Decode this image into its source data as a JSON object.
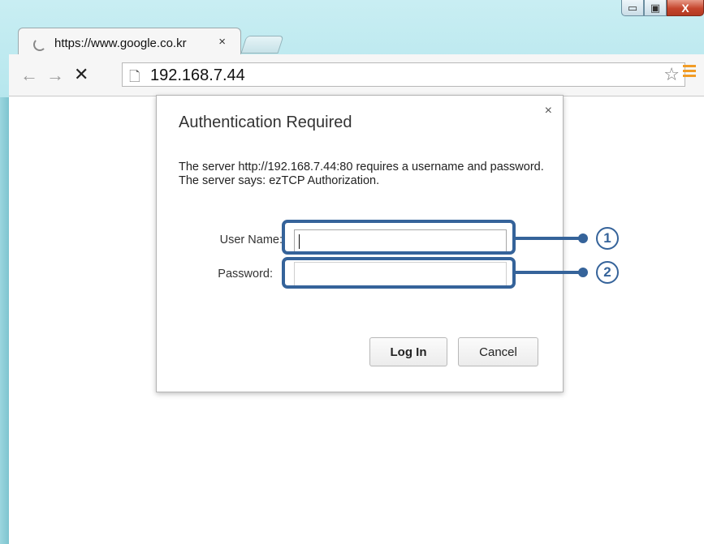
{
  "browser": {
    "tab": {
      "title": "https://www.google.co.kr",
      "close": "×"
    },
    "nav": {
      "back": "←",
      "forward": "→",
      "stop": "✕"
    },
    "address": {
      "url": "192.168.7.44"
    },
    "icons": [
      "page-icon",
      "star-icon",
      "menu-icon"
    ],
    "window_controls": {
      "minimize": "▭",
      "maximize": "▣",
      "close": "X"
    }
  },
  "dialog": {
    "title": "Authentication Required",
    "message": "The server http://192.168.7.44:80 requires a username and password. The server says: ezTCP Authorization.",
    "close": "×",
    "fields": {
      "username_label": "User Name:",
      "username_value": "",
      "password_label": "Password:",
      "password_value": ""
    },
    "buttons": {
      "login": "Log In",
      "cancel": "Cancel"
    }
  },
  "annotations": {
    "callout_1": "1",
    "callout_2": "2",
    "color": "#35639a"
  }
}
